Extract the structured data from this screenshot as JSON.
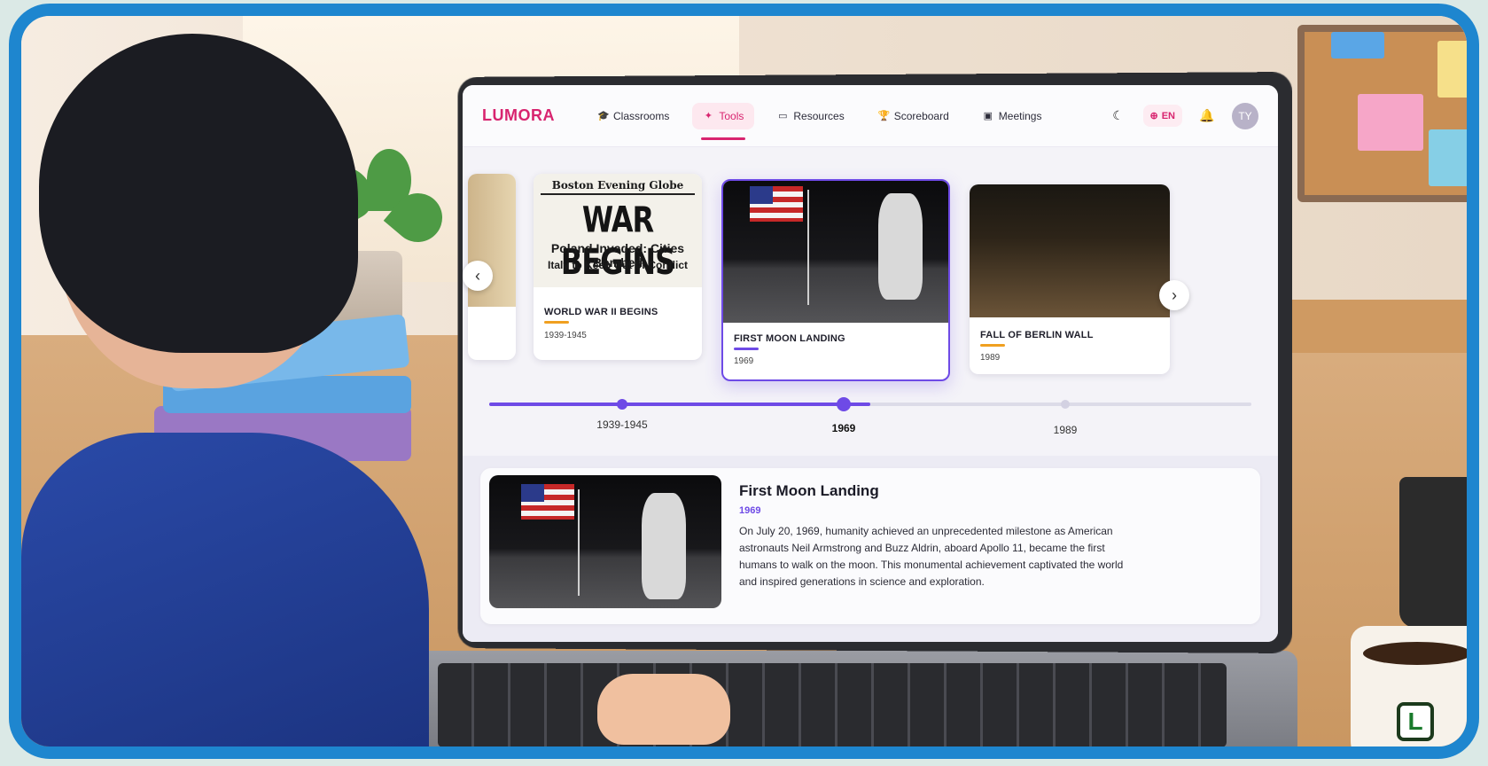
{
  "app": {
    "logo": "LUMORA"
  },
  "nav": {
    "items": [
      {
        "label": "Classrooms",
        "icon": "graduation-cap-icon"
      },
      {
        "label": "Tools",
        "icon": "magic-wand-icon",
        "active": true
      },
      {
        "label": "Resources",
        "icon": "folder-icon"
      },
      {
        "label": "Scoreboard",
        "icon": "trophy-icon"
      },
      {
        "label": "Meetings",
        "icon": "calendar-icon"
      }
    ],
    "language": "EN",
    "avatar_initials": "TY",
    "accent_color": "#d8246f"
  },
  "carousel": {
    "cards": [
      {
        "title": "WORLD WAR II BEGINS",
        "date": "1939-1945",
        "bar_color": "#f0a020",
        "newspaper": {
          "masthead": "Boston Evening Globe",
          "headline": "WAR BEGINS",
          "sub1": "Poland Invaded: Cities Bombed",
          "sub2": "Italy to Keep Out of Conflict"
        }
      },
      {
        "title": "FIRST MOON LANDING",
        "date": "1969",
        "bar_color": "#6e4ae6",
        "selected": true
      },
      {
        "title": "FALL OF BERLIN WALL",
        "date": "1989",
        "bar_color": "#f0a020"
      }
    ],
    "prev_label": "‹",
    "next_label": "›"
  },
  "timeline": {
    "points": [
      {
        "label": "1939-1945",
        "state": "done"
      },
      {
        "label": "1969",
        "state": "current"
      },
      {
        "label": "1989",
        "state": "upcoming"
      }
    ],
    "progress_fraction": 0.5,
    "accent_color": "#6e4ae6"
  },
  "detail": {
    "title": "First Moon Landing",
    "date": "1969",
    "description": "On July 20, 1969, humanity achieved an unprecedented milestone as American astronauts Neil Armstrong and Buzz Aldrin, aboard Apollo 11, became the first humans to walk on the moon. This monumental achievement captivated the world and inspired generations in science and exploration."
  },
  "scene": {
    "mug_letter": "L"
  }
}
